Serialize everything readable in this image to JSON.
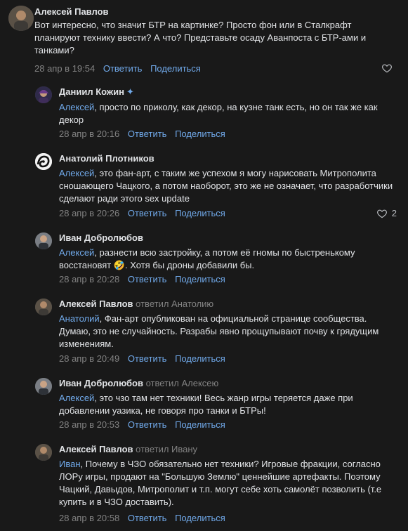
{
  "comments": [
    {
      "author": "Алексей Павлов",
      "replied": "",
      "mention": "",
      "text": "Вот интересно, что значит БТР на картинке? Просто фон или в Сталкрафт планируют технику ввести? А что? Представьте осаду Аванпоста с БТР-ами и танками?",
      "date": "28 апр в 19:54",
      "reply": "Ответить",
      "share": "Поделиться",
      "likes": ""
    },
    {
      "author": "Даниил Кожин",
      "replied": "",
      "mention": "Алексей",
      "text": ", просто по приколу, как декор, на кузне танк есть, но он так же как декор",
      "date": "28 апр в 20:16",
      "reply": "Ответить",
      "share": "Поделиться",
      "likes": ""
    },
    {
      "author": "Анатолий Плотников",
      "replied": "",
      "mention": "Алексей",
      "text": ", это фан-арт, с таким же успехом я могу нарисовать Митрополита сношающего Чацкого, а потом наоборот, это же не означает, что разработчики сделают ради этого sex update",
      "date": "28 апр в 20:26",
      "reply": "Ответить",
      "share": "Поделиться",
      "likes": "2"
    },
    {
      "author": "Иван Добролюбов",
      "replied": "",
      "mention": "Алексей",
      "text": ", разнести всю застройку, а потом её гномы по быстренькому восстановят",
      "emoji": "🤣",
      "text_after": ". Хотя бы дроны добавили бы.",
      "date": "28 апр в 20:28",
      "reply": "Ответить",
      "share": "Поделиться",
      "likes": ""
    },
    {
      "author": "Алексей Павлов",
      "replied": "ответил Анатолию",
      "mention": "Анатолий",
      "text": ", Фан-арт опубликован на официальной странице сообщества. Думаю, это не случайность. Разрабы явно прощупывают почву к грядущим изменениям.",
      "date": "28 апр в 20:49",
      "reply": "Ответить",
      "share": "Поделиться",
      "likes": ""
    },
    {
      "author": "Иван Добролюбов",
      "replied": "ответил Алексею",
      "mention": "Алексей",
      "text": ", это чзо там нет техники! Весь жанр игры теряется даже при добавлении уазика, не говоря про танки и БТРы!",
      "date": "28 апр в 20:53",
      "reply": "Ответить",
      "share": "Поделиться",
      "likes": ""
    },
    {
      "author": "Алексей Павлов",
      "replied": "ответил Ивану",
      "mention": "Иван",
      "text": ", Почему в ЧЗО обязательно нет техники? Игровые фракции, согласно ЛОРу игры, продают на \"Большую Землю\" ценнейшие артефакты. Поэтому Чацкий, Давыдов, Митрополит и т.п. могут себе хоть самолёт позволить (т.е купить и в ЧЗО доставить).",
      "date": "28 апр в 20:58",
      "reply": "Ответить",
      "share": "Поделиться",
      "likes": ""
    }
  ],
  "colors": {
    "background": "#191919",
    "text": "#e1e3e6",
    "link": "#71aaeb",
    "muted": "#828282"
  },
  "icons": {
    "verified": "verified-star-icon",
    "like": "heart-icon"
  }
}
